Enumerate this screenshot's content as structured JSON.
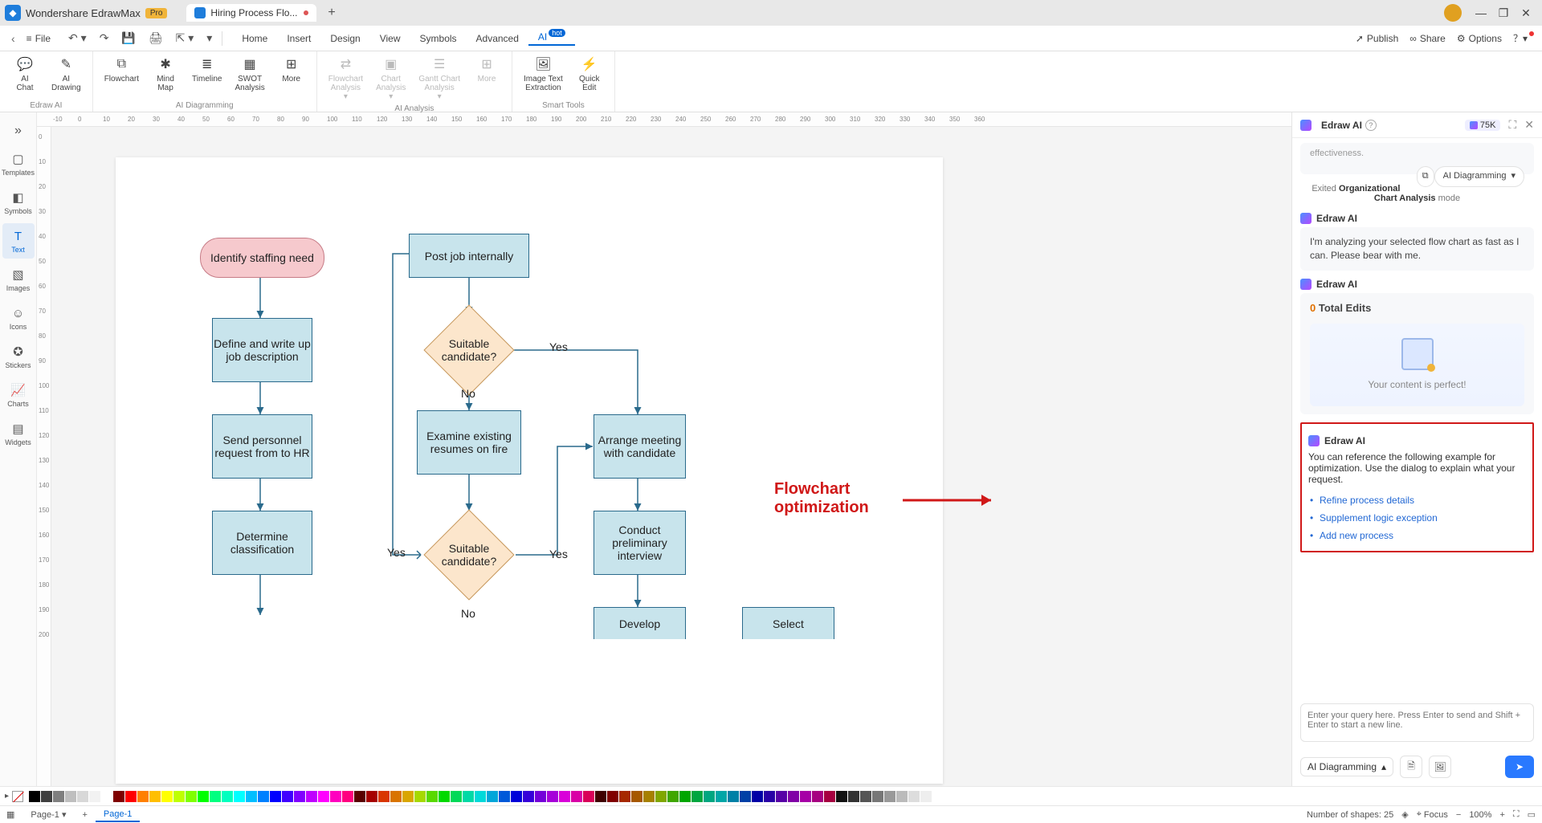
{
  "app": {
    "name": "Wondershare EdrawMax",
    "pro": "Pro"
  },
  "tab": {
    "title": "Hiring Process Flo..."
  },
  "menu": {
    "file": "File",
    "items": [
      "Home",
      "Insert",
      "Design",
      "View",
      "Symbols",
      "Advanced",
      "AI"
    ],
    "hot": "hot",
    "publish": "Publish",
    "share": "Share",
    "options": "Options"
  },
  "ribbon": {
    "g1_label": "Edraw AI",
    "g1": [
      {
        "l1": "AI",
        "l2": "Chat"
      },
      {
        "l1": "AI",
        "l2": "Drawing"
      }
    ],
    "g2_label": "AI Diagramming",
    "g2": [
      {
        "l1": "Flowchart",
        "l2": ""
      },
      {
        "l1": "Mind",
        "l2": "Map"
      },
      {
        "l1": "Timeline",
        "l2": ""
      },
      {
        "l1": "SWOT",
        "l2": "Analysis"
      },
      {
        "l1": "More",
        "l2": ""
      }
    ],
    "g3_label": "AI Analysis",
    "g3": [
      {
        "l1": "Flowchart",
        "l2": "Analysis"
      },
      {
        "l1": "Chart",
        "l2": "Analysis"
      },
      {
        "l1": "Gantt Chart",
        "l2": "Analysis"
      },
      {
        "l1": "More",
        "l2": ""
      }
    ],
    "g4_label": "Smart Tools",
    "g4": [
      {
        "l1": "Image Text",
        "l2": "Extraction"
      },
      {
        "l1": "Quick",
        "l2": "Edit"
      }
    ]
  },
  "left_tools": [
    "Templates",
    "Symbols",
    "Text",
    "Images",
    "Icons",
    "Stickers",
    "Charts",
    "Widgets"
  ],
  "ruler_h": [
    "-10",
    "0",
    "10",
    "20",
    "30",
    "40",
    "50",
    "60",
    "70",
    "80",
    "90",
    "100",
    "110",
    "120",
    "130",
    "140",
    "150",
    "160",
    "170",
    "180",
    "190",
    "200",
    "210",
    "220",
    "230",
    "240",
    "250",
    "260",
    "270",
    "280",
    "290",
    "300",
    "310",
    "320",
    "330",
    "340",
    "350",
    "360"
  ],
  "ruler_v": [
    "0",
    "10",
    "20",
    "30",
    "40",
    "50",
    "60",
    "70",
    "80",
    "90",
    "100",
    "110",
    "120",
    "130",
    "140",
    "150",
    "160",
    "170",
    "180",
    "190",
    "200"
  ],
  "shapes": {
    "s1": "Identify staffing need",
    "s2": "Define and write up job description",
    "s3": "Send personnel request from to HR",
    "s4": "Determine classification",
    "s5": "Post job internally",
    "s6": "Suitable candidate?",
    "s7": "Examine existing resumes on fire",
    "s8": "Suitable candidate?",
    "s9": "Arrange meeting with candidate",
    "s10": "Conduct preliminary interview",
    "s11": "Develop",
    "s12": "Select",
    "yes1": "Yes",
    "no1": "No",
    "yes2": "Yes",
    "yes3": "Yes",
    "no2": "No"
  },
  "annotation": {
    "l1": "Flowchart",
    "l2": "optimization"
  },
  "ai": {
    "title": "Edraw AI",
    "tokens": "75K",
    "top_trail": "effectiveness.",
    "mode_badge": "AI Diagramming",
    "exit_pre": "Exited ",
    "exit_b": "Organizational Chart Analysis",
    "exit_post": " mode",
    "analyzing": "I'm analyzing your selected flow chart as fast as I can. Please bear with me.",
    "total_num": "0",
    "total_label": " Total Edits",
    "perfect": "Your content is perfect!",
    "suggest_intro": "You can reference the following example for optimization. Use the dialog to explain what your request.",
    "suggest": [
      "Refine process details",
      "Supplement logic exception",
      "Add new process"
    ],
    "placeholder": "Enter your query here. Press Enter to send and Shift + Enter to start a new line.",
    "combo": "AI Diagramming"
  },
  "status": {
    "page_combo": "Page-1",
    "page_tab": "Page-1",
    "shapes_label": "Number of shapes: ",
    "shapes": "25",
    "focus": "Focus",
    "zoom": "100%"
  },
  "colors": [
    "#000000",
    "#3f3f3f",
    "#7f7f7f",
    "#bfbfbf",
    "#d8d8d8",
    "#f2f2f2",
    "#ffffff",
    "#7f0000",
    "#ff0000",
    "#ff8000",
    "#ffbf00",
    "#ffff00",
    "#bfff00",
    "#80ff00",
    "#00ff00",
    "#00ff80",
    "#00ffbf",
    "#00ffff",
    "#00bfff",
    "#0080ff",
    "#0000ff",
    "#4000ff",
    "#8000ff",
    "#bf00ff",
    "#ff00ff",
    "#ff00bf",
    "#ff0080",
    "#590000",
    "#a60000",
    "#d93600",
    "#d97400",
    "#d9a600",
    "#a6d900",
    "#59d900",
    "#00d900",
    "#00d959",
    "#00d9a6",
    "#00d9d9",
    "#00a6d9",
    "#0059d9",
    "#0000d9",
    "#3600d9",
    "#7400d9",
    "#a600d9",
    "#d900d9",
    "#d900a6",
    "#d90059",
    "#400000",
    "#800000",
    "#a62900",
    "#a65800",
    "#a68000",
    "#80a600",
    "#40a600",
    "#00a600",
    "#00a640",
    "#00a680",
    "#00a6a6",
    "#0080a6",
    "#0040a6",
    "#0000a6",
    "#2900a6",
    "#5800a6",
    "#8000a6",
    "#a600a6",
    "#a60080",
    "#a60040",
    "#111",
    "#333",
    "#555",
    "#777",
    "#999",
    "#bbb",
    "#ddd",
    "#eee"
  ]
}
